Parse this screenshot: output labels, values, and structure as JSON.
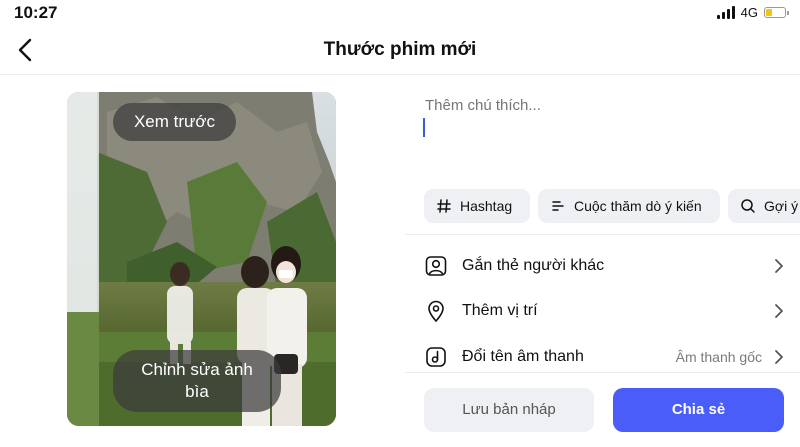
{
  "status_bar": {
    "time": "10:27",
    "network": "4G",
    "battery_level": 0.35
  },
  "header": {
    "title": "Thước phim mới"
  },
  "media": {
    "preview_label": "Xem trước",
    "cover_edit_line1": "Chỉnh sửa ảnh",
    "cover_edit_line2": "bìa"
  },
  "caption": {
    "placeholder": "Thêm chú thích..."
  },
  "chips": {
    "hashtag": "Hashtag",
    "poll": "Cuộc thăm dò ý kiến",
    "suggest": "Gợi ý"
  },
  "options": {
    "tag_people": "Gắn thẻ người khác",
    "add_location": "Thêm vị trí",
    "rename_audio": "Đổi tên âm thanh",
    "rename_audio_value": "Âm thanh gốc"
  },
  "actions": {
    "save_draft": "Lưu bản nháp",
    "share": "Chia sẻ"
  },
  "colors": {
    "accent": "#4a5df9",
    "chip_bg": "#eef0f3",
    "cursor": "#3a5ccc",
    "battery": "#f3c414"
  }
}
